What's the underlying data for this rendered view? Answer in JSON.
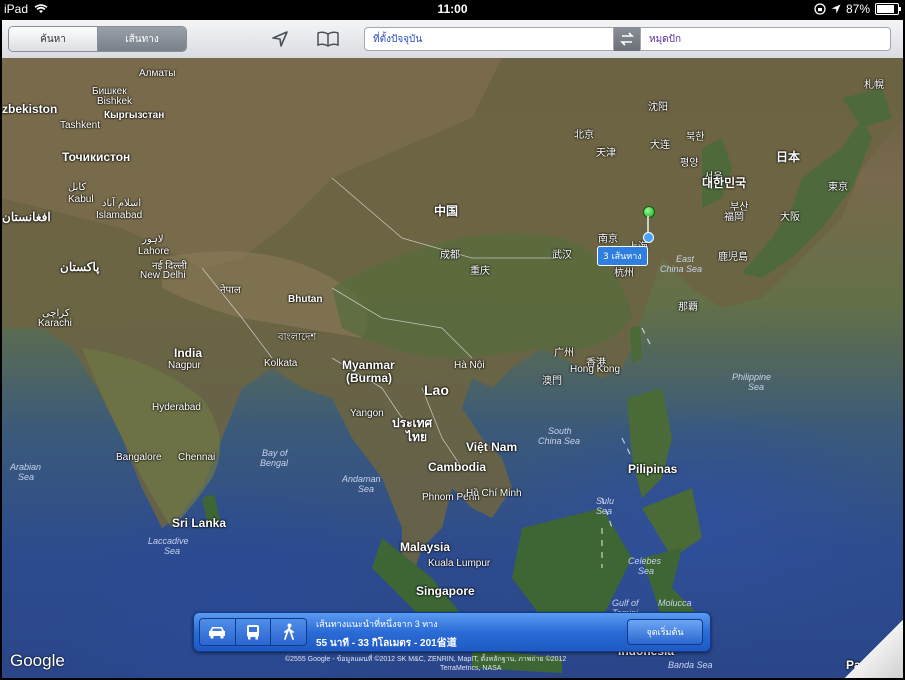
{
  "status_bar": {
    "device": "iPad",
    "time": "11:00",
    "battery_percent": "87%"
  },
  "toolbar": {
    "segments": [
      "ค้นหา",
      "เส้นทาง"
    ],
    "selected_segment": 1,
    "from_field": "ที่ตั้งปัจจุบัน",
    "to_field": "หมุดปัก"
  },
  "map": {
    "labels": {
      "kazakhstan_city": "Алматы",
      "bishkek_ru": "Бишкек",
      "bishkek": "Bishkek",
      "kyrgyzstan": "Кыргызстан",
      "uzbekistan": "zbekiston",
      "tashkent": "Tashkent",
      "tajikistan": "Точикистон",
      "kabul_ar": "کابل",
      "kabul": "Kabul",
      "afghanistan": "افغانستان",
      "islamabad_ar": "اسلام آباد",
      "islamabad": "Islamabad",
      "lahore_ar": "لاہور",
      "lahore": "Lahore",
      "pakistan": "پاکستان",
      "new_delhi_hi": "नई दिल्ली",
      "new_delhi": "New Delhi",
      "karachi_ar": "کراچی",
      "karachi": "Karachi",
      "india": "India",
      "nagpur": "Nagpur",
      "hyderabad": "Hyderabad",
      "bangalore": "Bangalore",
      "chennai": "Chennai",
      "sri_lanka": "Sri Lanka",
      "kathmandu": "नेपाल",
      "bhutan": "Bhutan",
      "bangladesh": "বাংলাদেশ",
      "kolkata": "Kolkata",
      "myanmar": "Myanmar",
      "burma": "(Burma)",
      "yangon": "Yangon",
      "lao": "Lao",
      "thailand1": "ประเทศ",
      "thailand2": "ไทย",
      "ha_noi": "Hà Nội",
      "viet_nam": "Việt Nam",
      "cambodia": "Cambodia",
      "phnom_penh": "Phnom Penh",
      "ho_chi_minh": "Hồ Chí Minh",
      "malaysia": "Malaysia",
      "kuala_lumpur": "Kuala Lumpur",
      "singapore": "Singapore",
      "china": "中国",
      "beijing": "北京",
      "tianjin": "天津",
      "shenyang": "沈阳",
      "dalian": "大连",
      "chengdu": "成都",
      "chongqing": "重庆",
      "wuhan": "武汉",
      "nanjing": "南京",
      "shanghai": "上海",
      "hangzhou": "杭州",
      "guangzhou": "广州",
      "hongkong_cn": "香港",
      "hongkong": "Hong Kong",
      "macau": "澳門",
      "north_korea": "북한",
      "pyongyang": "평양",
      "seoul": "서울",
      "south_korea": "대한민국",
      "busan": "부산",
      "japan": "日本",
      "tokyo": "東京",
      "osaka": "大阪",
      "fukuoka": "福岡",
      "kagoshima": "鹿児島",
      "naha": "那覇",
      "sapporo": "札幌",
      "east_china_sea1": "East",
      "east_china_sea2": "China Sea",
      "south_china_sea1": "South",
      "south_china_sea2": "China Sea",
      "philippine_sea1": "Philippine",
      "philippine_sea2": "Sea",
      "pilipinas": "Pilipinas",
      "sulu_sea1": "Sulu",
      "sulu_sea2": "Sea",
      "celebes_sea1": "Celebes",
      "celebes_sea2": "Sea",
      "gulf_of_tomini1": "Gulf of",
      "gulf_of_tomini2": "Tomini",
      "molucca_sea": "Molucca",
      "indonesia": "Indonesia",
      "banda_sea": "Banda Sea",
      "arabian_sea1": "Arabian",
      "arabian_sea2": "Sea",
      "bay_of_bengal1": "Bay of",
      "bay_of_bengal2": "Bengal",
      "andaman_sea1": "Andaman",
      "andaman_sea2": "Sea",
      "laccadive_sea1": "Laccadive",
      "laccadive_sea2": "Sea",
      "papua": "Pa"
    },
    "route_bubble": "3 เส้นทาง",
    "google_logo": "Google",
    "credit_line1": "©2555 Google - ข้อมูลแผนที่ ©2012 SK M&C, ZENRIN, MapIT, ตั้งหลักฐาน, ภาพถ่าย ©2012",
    "credit_line2": "TerraMetrics, NASA"
  },
  "route_bar": {
    "modes": [
      "car-icon",
      "bus-icon",
      "walk-icon"
    ],
    "line1": "เส้นทางแนะนำที่หนึ่งจาก 3 ทาง",
    "line2": "55 นาที - 33 กิโลเมตร - 201省道",
    "start_button": "จุดเริ่มต้น"
  }
}
